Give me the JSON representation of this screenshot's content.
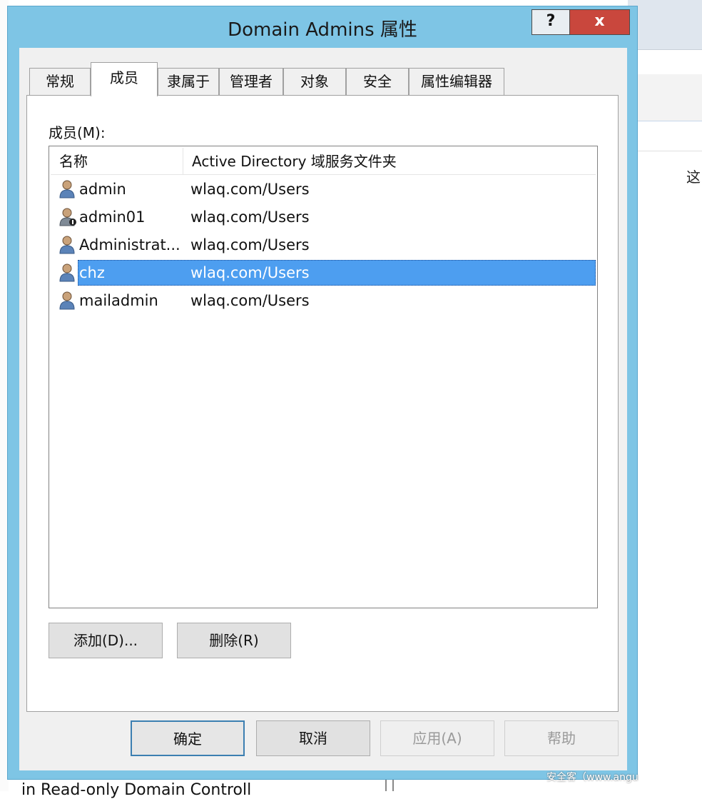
{
  "dialog": {
    "title": "Domain Admins 属性",
    "help_glyph": "?",
    "close_glyph": "x"
  },
  "tabs": [
    {
      "label": "常规"
    },
    {
      "label": "成员"
    },
    {
      "label": "隶属于"
    },
    {
      "label": "管理者"
    },
    {
      "label": "对象"
    },
    {
      "label": "安全"
    },
    {
      "label": "属性编辑器"
    }
  ],
  "active_tab": "成员",
  "members": {
    "label": "成员(M):",
    "columns": [
      "名称",
      "Active Directory 域服务文件夹"
    ],
    "rows": [
      {
        "name": "admin",
        "folder": "wlaq.com/Users",
        "icon": "user-icon"
      },
      {
        "name": "admin01",
        "folder": "wlaq.com/Users",
        "icon": "user-disabled-icon"
      },
      {
        "name": "Administrat...",
        "folder": "wlaq.com/Users",
        "icon": "user-icon"
      },
      {
        "name": "chz",
        "folder": "wlaq.com/Users",
        "icon": "user-icon",
        "selected": true
      },
      {
        "name": "mailadmin",
        "folder": "wlaq.com/Users",
        "icon": "user-icon"
      }
    ],
    "add_label": "添加(D)...",
    "remove_label": "删除(R)"
  },
  "footer": {
    "ok_label": "确定",
    "cancel_label": "取消",
    "apply_label": "应用(A)",
    "help_label": "帮助"
  },
  "background": {
    "right_char": "这",
    "bottom_text": "in Read-only Domain Controll",
    "watermark": "安全客（www.angu"
  },
  "colors": {
    "titlebar": "#7ec5e5",
    "close_button": "#c9473d",
    "selection": "#4d9ef0"
  }
}
